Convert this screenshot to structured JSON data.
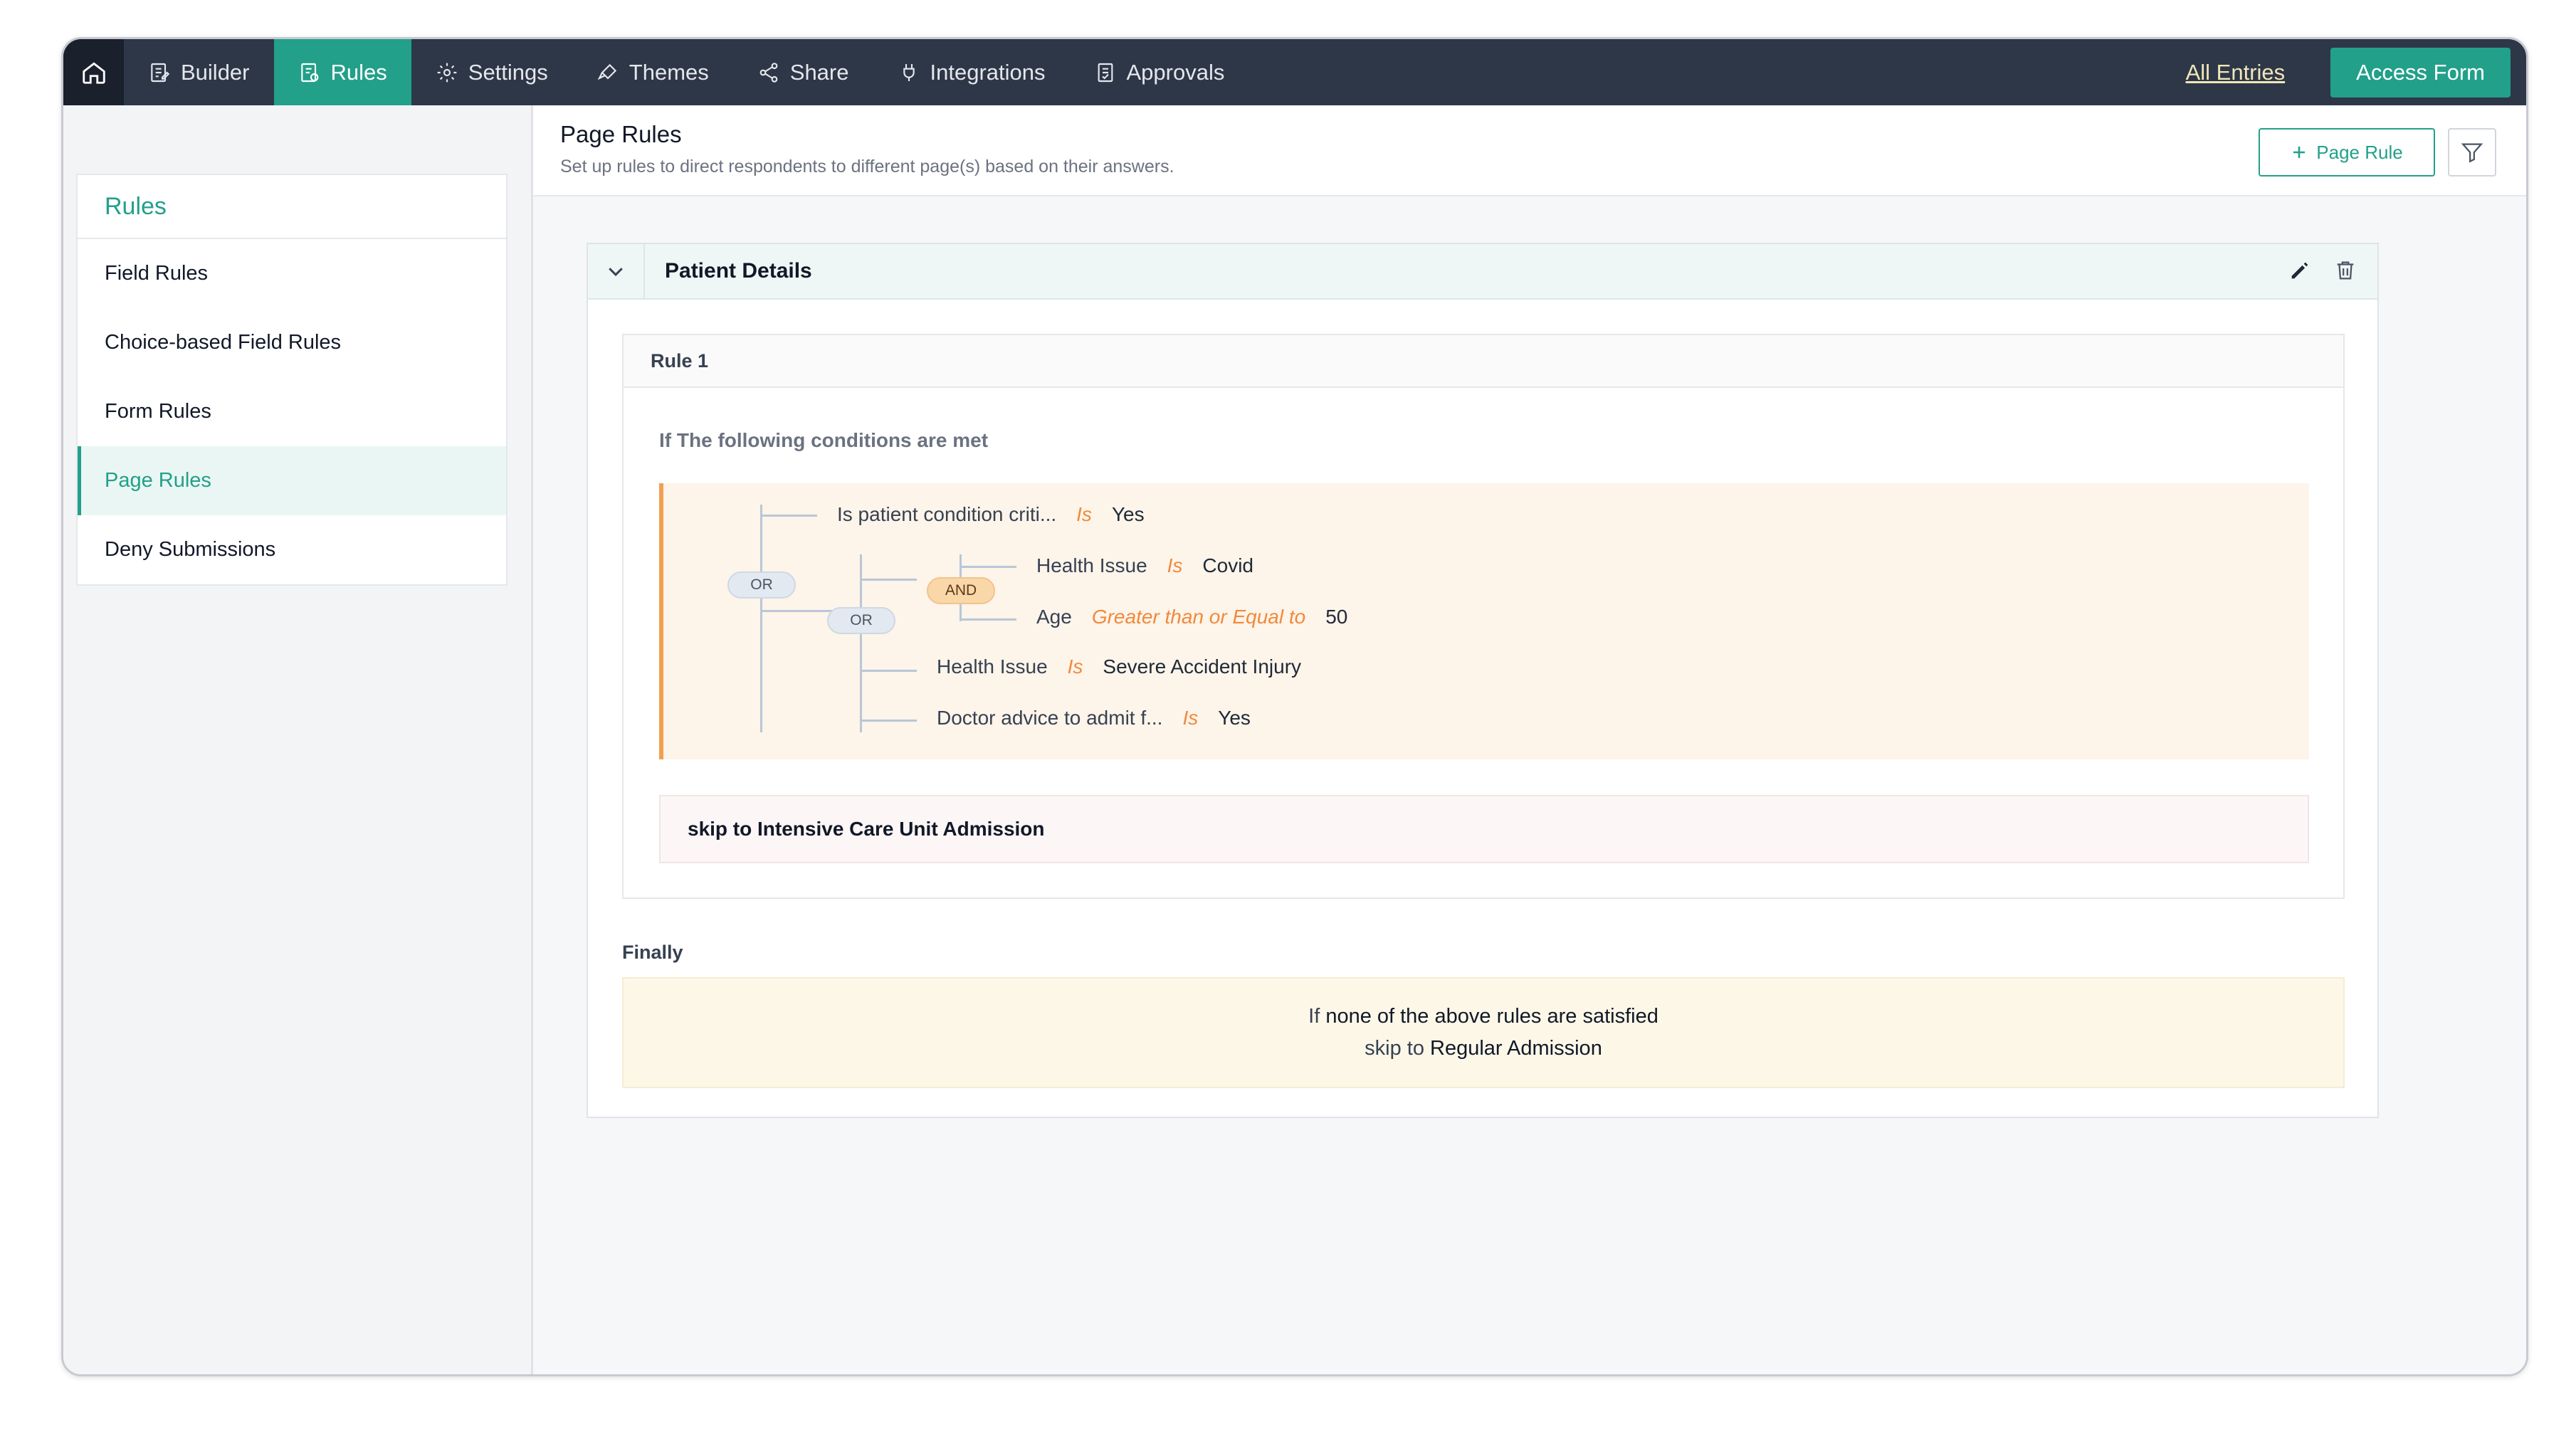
{
  "nav": {
    "tabs": [
      {
        "label": "Builder",
        "icon": "builder-icon"
      },
      {
        "label": "Rules",
        "icon": "rules-icon"
      },
      {
        "label": "Settings",
        "icon": "gear-icon"
      },
      {
        "label": "Themes",
        "icon": "brush-icon"
      },
      {
        "label": "Share",
        "icon": "share-icon"
      },
      {
        "label": "Integrations",
        "icon": "plug-icon"
      },
      {
        "label": "Approvals",
        "icon": "approvals-icon"
      }
    ],
    "active_tab": "Rules",
    "all_entries": "All Entries",
    "access_form": "Access Form"
  },
  "sidebar": {
    "title": "Rules",
    "items": [
      {
        "label": "Field Rules"
      },
      {
        "label": "Choice-based Field Rules"
      },
      {
        "label": "Form Rules"
      },
      {
        "label": "Page Rules"
      },
      {
        "label": "Deny Submissions"
      }
    ],
    "active_item": "Page Rules"
  },
  "main": {
    "title": "Page Rules",
    "subtitle": "Set up rules to direct respondents to different page(s) based on their answers.",
    "add_button": "Page Rule"
  },
  "section": {
    "title": "Patient Details",
    "rule": {
      "title": "Rule 1",
      "condition_label": "If The following conditions are met",
      "groups": {
        "outer": "OR",
        "inner": "OR",
        "innermost": "AND"
      },
      "conditions": [
        {
          "field": "Is patient condition criti...",
          "op": "Is",
          "value": "Yes"
        },
        {
          "field": "Health Issue",
          "op": "Is",
          "value": "Covid"
        },
        {
          "field": "Age",
          "op": "Greater than or Equal to",
          "value": "50"
        },
        {
          "field": "Health Issue",
          "op": "Is",
          "value": "Severe Accident Injury"
        },
        {
          "field": "Doctor advice to admit f...",
          "op": "Is",
          "value": "Yes"
        }
      ],
      "action": "skip to Intensive Care Unit Admission"
    },
    "finally": {
      "label": "Finally",
      "line1_prefix": "If ",
      "line1_bold": "none of the above rules are satisfied",
      "line2_prefix": "skip to ",
      "line2_bold": "Regular Admission"
    }
  },
  "colors": {
    "accent": "#22a08a",
    "nav_bg": "#2d3748",
    "operator": "#f08a3c",
    "condition_bg": "#fdf4ea"
  }
}
